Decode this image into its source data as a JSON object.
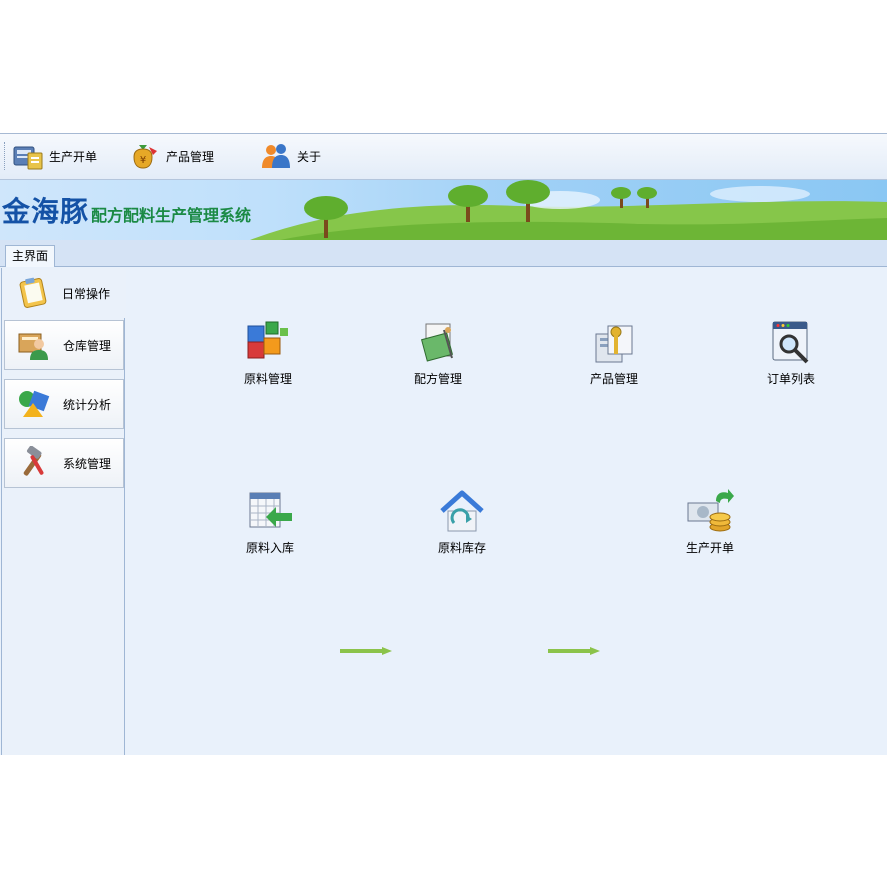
{
  "toolbar": {
    "items": [
      {
        "label": "生产开单",
        "icon": "production-order-icon"
      },
      {
        "label": "产品管理",
        "icon": "money-bag-icon"
      },
      {
        "label": "关于",
        "icon": "users-icon"
      }
    ]
  },
  "banner": {
    "brand": "金海豚",
    "subtitle": "配方配料生产管理系统"
  },
  "tabs": [
    {
      "label": "主界面"
    }
  ],
  "leftnav": {
    "items": [
      {
        "label": "日常操作",
        "icon": "clipboard-icon"
      },
      {
        "label": "仓库管理",
        "icon": "warehouse-person-icon"
      },
      {
        "label": "统计分析",
        "icon": "shapes-chart-icon"
      },
      {
        "label": "系统管理",
        "icon": "tools-icon"
      }
    ]
  },
  "main": {
    "row1": [
      {
        "label": "原料管理",
        "icon": "cubes-icon"
      },
      {
        "label": "配方管理",
        "icon": "formula-book-icon"
      },
      {
        "label": "产品管理",
        "icon": "product-key-icon"
      },
      {
        "label": "订单列表",
        "icon": "search-window-icon"
      }
    ],
    "row2": [
      {
        "label": "原料入库",
        "icon": "calendar-arrow-icon"
      },
      {
        "label": "原料库存",
        "icon": "house-refresh-icon"
      },
      {
        "label": "生产开单",
        "icon": "money-coins-icon"
      }
    ]
  },
  "colors": {
    "brand_blue": "#1452a6",
    "subtitle_green": "#1b8a45",
    "arrow_green": "#8bc34a"
  }
}
